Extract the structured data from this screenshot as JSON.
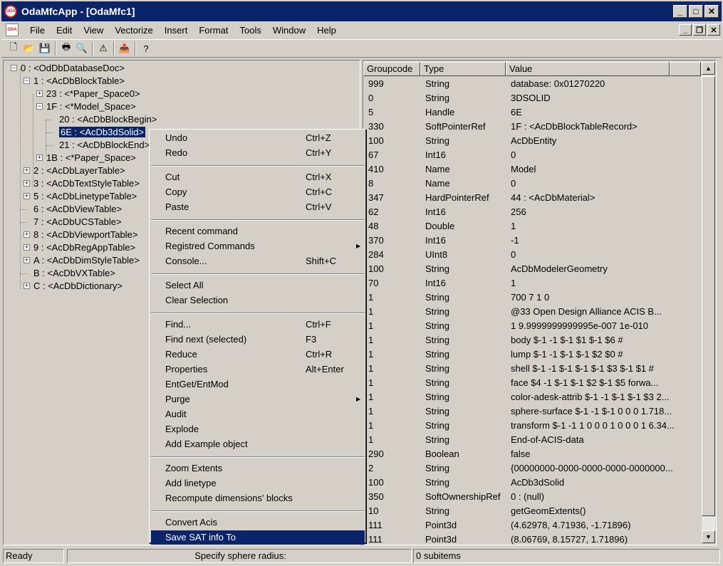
{
  "window": {
    "title": "OdaMfcApp - [OdaMfc1]",
    "app_icon_text": "ODA",
    "minimize": "_",
    "maximize": "□",
    "close": "✕",
    "mdi_minimize": "_",
    "mdi_restore": "❐",
    "mdi_close": "✕"
  },
  "menubar": {
    "items": [
      "File",
      "Edit",
      "View",
      "Vectorize",
      "Insert",
      "Format",
      "Tools",
      "Window",
      "Help"
    ]
  },
  "toolbar": {
    "buttons": [
      {
        "name": "new-icon",
        "glyph": "🗋"
      },
      {
        "name": "open-folder-icon",
        "glyph": "📂"
      },
      {
        "name": "save-icon",
        "glyph": "💾"
      },
      {
        "name": "print-icon",
        "glyph": "🖶"
      },
      {
        "name": "print-preview-icon",
        "glyph": "🔍"
      },
      {
        "name": "warning-icon",
        "glyph": "⚠"
      },
      {
        "name": "export-icon",
        "glyph": "📤"
      },
      {
        "name": "help-icon",
        "glyph": "?"
      }
    ]
  },
  "tree": {
    "nodes": [
      {
        "label": "0 : <OdDbDatabaseDoc>",
        "expander": "−"
      },
      {
        "label": "1 : <AcDbBlockTable>",
        "expander": "−"
      },
      {
        "label": "23 : <*Paper_Space0>",
        "expander": "+"
      },
      {
        "label": "1F : <*Model_Space>",
        "expander": "−"
      },
      {
        "label": "20 : <AcDbBlockBegin>",
        "expander": ""
      },
      {
        "label": "6E : <AcDb3dSolid>",
        "expander": "",
        "selected": true
      },
      {
        "label": "21 : <AcDbBlockEnd>",
        "expander": ""
      },
      {
        "label": "1B : <*Paper_Space>",
        "expander": "+"
      },
      {
        "label": "2 : <AcDbLayerTable>",
        "expander": "+"
      },
      {
        "label": "3 : <AcDbTextStyleTable>",
        "expander": "+"
      },
      {
        "label": "5 : <AcDbLinetypeTable>",
        "expander": "+"
      },
      {
        "label": "6 : <AcDbViewTable>",
        "expander": ""
      },
      {
        "label": "7 : <AcDbUCSTable>",
        "expander": ""
      },
      {
        "label": "8 : <AcDbViewportTable>",
        "expander": "+"
      },
      {
        "label": "9 : <AcDbRegAppTable>",
        "expander": "+"
      },
      {
        "label": "A : <AcDbDimStyleTable>",
        "expander": "+"
      },
      {
        "label": "B : <AcDbVXTable>",
        "expander": ""
      },
      {
        "label": "C : <AcDbDictionary>",
        "expander": "+"
      }
    ]
  },
  "list": {
    "columns": [
      "Groupcode",
      "Type",
      "Value"
    ],
    "rows": [
      [
        "999",
        "String",
        "database: 0x01270220"
      ],
      [
        "0",
        "String",
        "3DSOLID"
      ],
      [
        "5",
        "Handle",
        "6E"
      ],
      [
        "330",
        "SoftPointerRef",
        "1F : <AcDbBlockTableRecord>"
      ],
      [
        "100",
        "String",
        "AcDbEntity"
      ],
      [
        "67",
        "Int16",
        "0"
      ],
      [
        "410",
        "Name",
        "Model"
      ],
      [
        "8",
        "Name",
        "0"
      ],
      [
        "347",
        "HardPointerRef",
        "44 : <AcDbMaterial>"
      ],
      [
        "62",
        "Int16",
        "256"
      ],
      [
        "48",
        "Double",
        "1"
      ],
      [
        "370",
        "Int16",
        "-1"
      ],
      [
        "284",
        "UInt8",
        "0"
      ],
      [
        "100",
        "String",
        "AcDbModelerGeometry"
      ],
      [
        "70",
        "Int16",
        "1"
      ],
      [
        "1",
        "String",
        "700 7 1 0"
      ],
      [
        "1",
        "String",
        "@33 Open Design Alliance ACIS B..."
      ],
      [
        "1",
        "String",
        "1 9.9999999999995e-007 1e-010"
      ],
      [
        "1",
        "String",
        "body $-1 -1 $-1 $1 $-1 $6 #"
      ],
      [
        "1",
        "String",
        "lump $-1 -1 $-1 $-1 $2 $0 #"
      ],
      [
        "1",
        "String",
        "shell $-1 -1 $-1 $-1 $-1 $3 $-1 $1 #"
      ],
      [
        "1",
        "String",
        "face $4 -1 $-1 $-1 $2 $-1 $5 forwa..."
      ],
      [
        "1",
        "String",
        "color-adesk-attrib $-1 -1 $-1 $-1 $3 2..."
      ],
      [
        "1",
        "String",
        "sphere-surface $-1 -1 $-1 0 0 0 1.718..."
      ],
      [
        "1",
        "String",
        "transform $-1 -1 1 0 0 0 1 0 0 0 1 6.34..."
      ],
      [
        "1",
        "String",
        "End-of-ACIS-data"
      ],
      [
        "290",
        "Boolean",
        "false"
      ],
      [
        "2",
        "String",
        "{00000000-0000-0000-0000-0000000..."
      ],
      [
        "100",
        "String",
        "AcDb3dSolid"
      ],
      [
        "350",
        "SoftOwnershipRef",
        "0 : (null)"
      ],
      [
        "10",
        "String",
        "getGeomExtents()"
      ],
      [
        "111",
        "Point3d",
        "(4.62978, 4.71936, -1.71896)"
      ],
      [
        "111",
        "Point3d",
        "(8.06769, 8.15727, 1.71896)"
      ]
    ]
  },
  "context_menu": {
    "groups": [
      [
        {
          "label": "Undo",
          "shortcut": "Ctrl+Z"
        },
        {
          "label": "Redo",
          "shortcut": "Ctrl+Y"
        }
      ],
      [
        {
          "label": "Cut",
          "shortcut": "Ctrl+X"
        },
        {
          "label": "Copy",
          "shortcut": "Ctrl+C"
        },
        {
          "label": "Paste",
          "shortcut": "Ctrl+V"
        }
      ],
      [
        {
          "label": "Recent command",
          "shortcut": ""
        },
        {
          "label": "Registred Commands",
          "shortcut": "",
          "submenu": true
        },
        {
          "label": "Console...",
          "shortcut": "Shift+C"
        }
      ],
      [
        {
          "label": "Select All",
          "shortcut": ""
        },
        {
          "label": "Clear Selection",
          "shortcut": ""
        }
      ],
      [
        {
          "label": "Find...",
          "shortcut": "Ctrl+F"
        },
        {
          "label": "Find next (selected)",
          "shortcut": "F3"
        },
        {
          "label": "Reduce",
          "shortcut": "Ctrl+R"
        },
        {
          "label": "Properties",
          "shortcut": "Alt+Enter"
        },
        {
          "label": "EntGet/EntMod",
          "shortcut": ""
        },
        {
          "label": "Purge",
          "shortcut": "",
          "submenu": true
        },
        {
          "label": "Audit",
          "shortcut": ""
        },
        {
          "label": "Explode",
          "shortcut": ""
        },
        {
          "label": "Add Example object",
          "shortcut": ""
        }
      ],
      [
        {
          "label": "Zoom Extents",
          "shortcut": ""
        },
        {
          "label": "Add linetype",
          "shortcut": ""
        },
        {
          "label": "Recompute dimensions' blocks",
          "shortcut": ""
        }
      ],
      [
        {
          "label": "Convert Acis",
          "shortcut": ""
        },
        {
          "label": "Save SAT info To",
          "shortcut": "",
          "highlight": true
        }
      ]
    ]
  },
  "statusbar": {
    "ready": "Ready",
    "prompt": "Specify sphere radius:",
    "subitems": "0 subitems"
  },
  "scrollbar": {
    "up": "▲",
    "down": "▼"
  }
}
